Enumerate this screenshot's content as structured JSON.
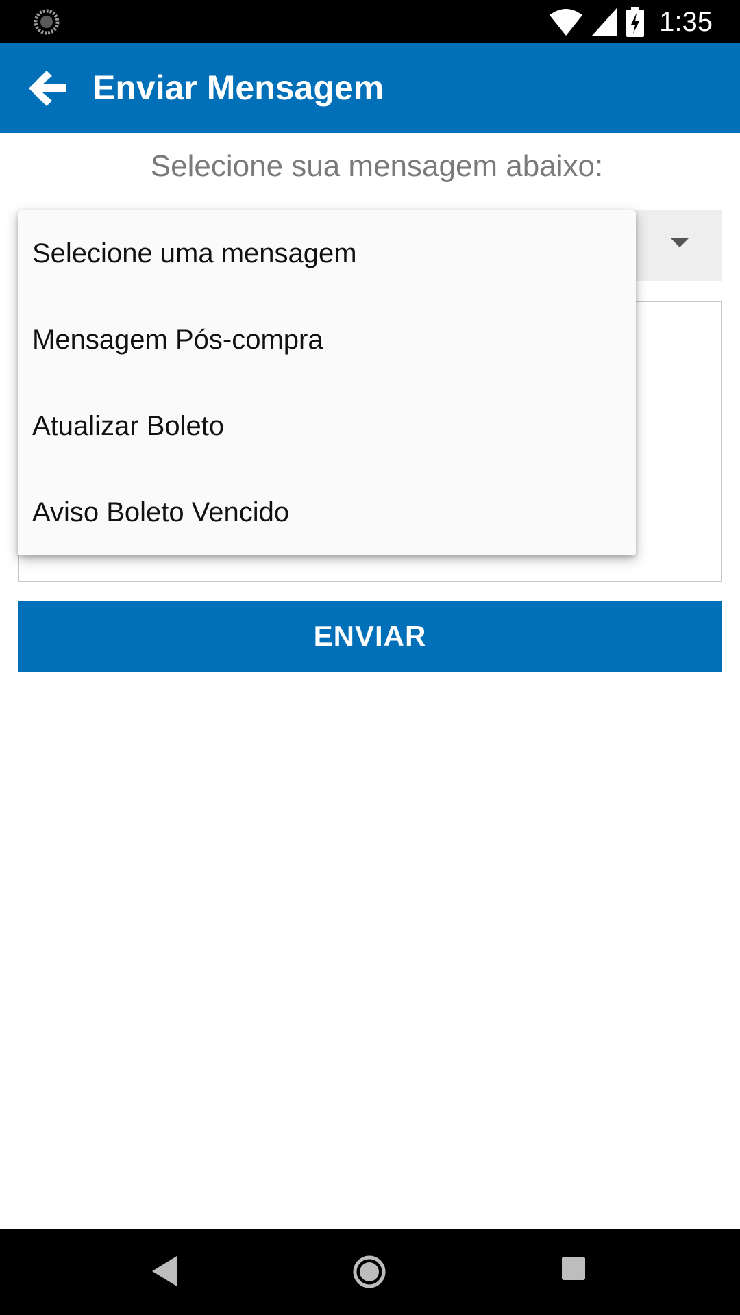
{
  "status_bar": {
    "time": "1:35",
    "icons": [
      "sync-icon",
      "wifi-icon",
      "cell-signal-icon",
      "battery-charging-icon"
    ]
  },
  "app_bar": {
    "title": "Enviar Mensagem",
    "back_icon": "arrow-left-icon",
    "background": "#0270b9"
  },
  "form": {
    "subtitle": "Selecione sua mensagem abaixo:",
    "spinner_icon": "caret-down-icon",
    "send_label": "ENVIAR"
  },
  "dropdown": {
    "options": [
      "Selecione uma mensagem",
      "Mensagem Pós-compra",
      "Atualizar Boleto",
      "Aviso Boleto Vencido"
    ]
  },
  "nav_bar": {
    "icons": [
      "nav-back-icon",
      "nav-home-icon",
      "nav-recents-icon"
    ]
  },
  "colors": {
    "accent": "#0270b9",
    "subtitle_text": "#7a7a7a",
    "menu_background": "#fafafa"
  }
}
